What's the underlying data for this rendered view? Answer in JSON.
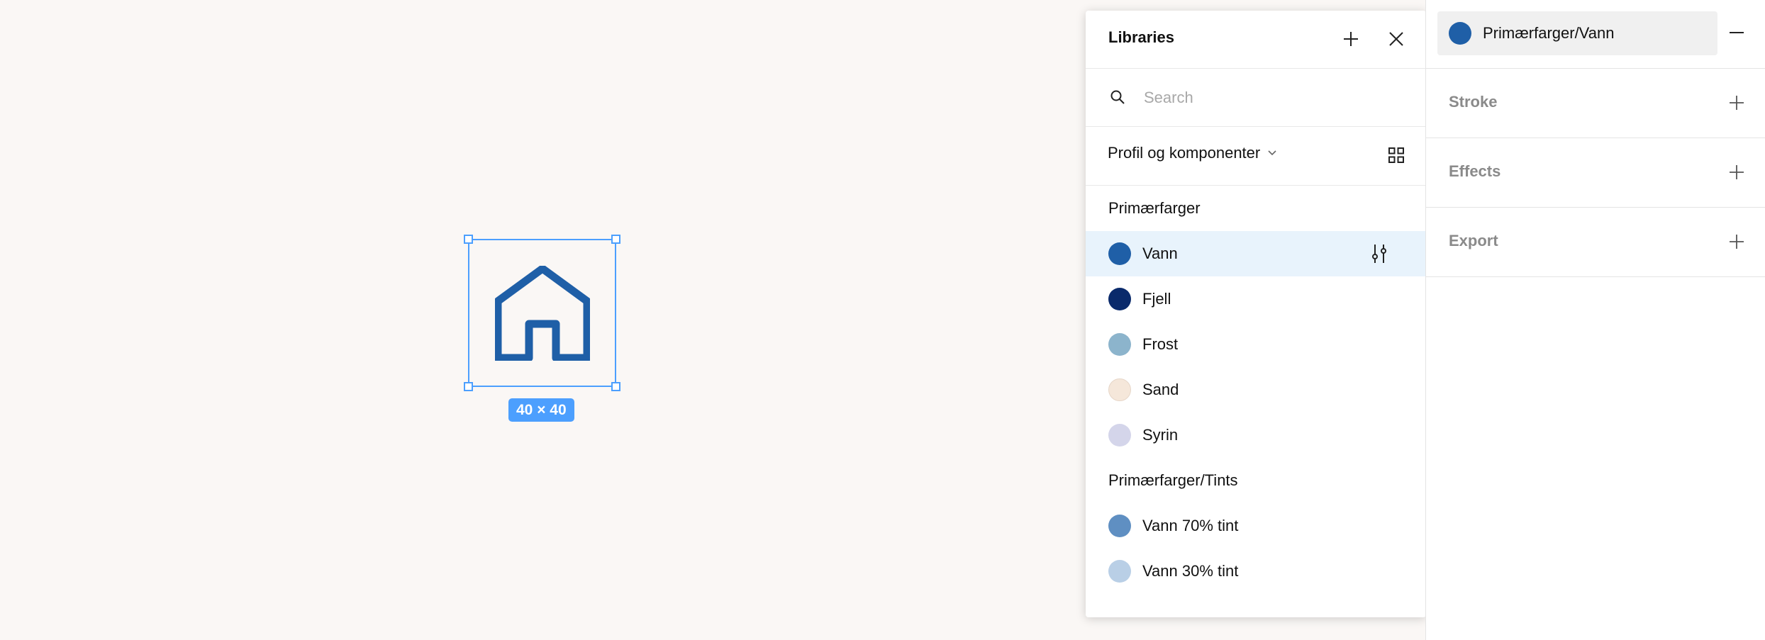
{
  "canvas": {
    "selection_size": "40 × 40",
    "icon": "home-icon"
  },
  "libraries": {
    "title": "Libraries",
    "search": {
      "placeholder": "Search",
      "value": ""
    },
    "filter": {
      "label": "Profil og komponenter"
    },
    "sections": [
      {
        "title": "Primærfarger",
        "colors": [
          {
            "name": "Vann",
            "hex": "#1f5fa7",
            "selected": true
          },
          {
            "name": "Fjell",
            "hex": "#0a2a6b"
          },
          {
            "name": "Frost",
            "hex": "#8cb4cc"
          },
          {
            "name": "Sand",
            "hex": "#f5e7da"
          },
          {
            "name": "Syrin",
            "hex": "#d4d5ea"
          }
        ]
      },
      {
        "title": "Primærfarger/Tints",
        "colors": [
          {
            "name": "Vann 70% tint",
            "hex": "#5f8fc2"
          },
          {
            "name": "Vann 30% tint",
            "hex": "#b9cfe6"
          }
        ]
      }
    ]
  },
  "properties": {
    "fill": {
      "style_name": "Primærfarger/Vann",
      "hex": "#1f5fa7"
    },
    "sections": [
      {
        "label": "Stroke"
      },
      {
        "label": "Effects"
      },
      {
        "label": "Export"
      }
    ]
  },
  "colors": {
    "accent": "#4c9ffe",
    "icon_stroke": "#1f5fa7",
    "canvas_bg": "#faf7f5",
    "selected_row": "#e8f3fc"
  }
}
